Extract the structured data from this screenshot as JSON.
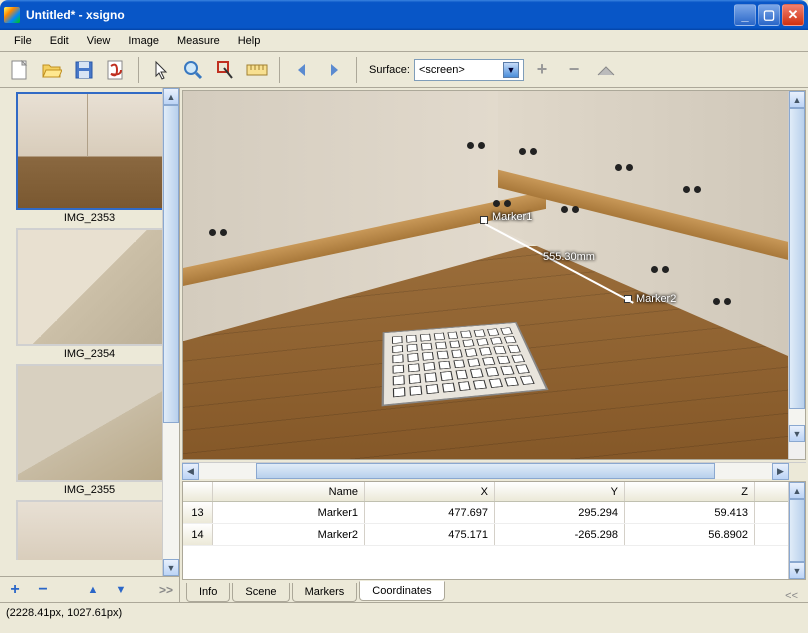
{
  "window": {
    "title": "Untitled* - xsigno"
  },
  "menu": {
    "items": [
      "File",
      "Edit",
      "View",
      "Image",
      "Measure",
      "Help"
    ]
  },
  "toolbar": {
    "surface_label": "Surface:",
    "surface_value": "<screen>"
  },
  "thumbs": [
    {
      "label": "IMG_2353",
      "selected": true
    },
    {
      "label": "IMG_2354",
      "selected": false
    },
    {
      "label": "IMG_2355",
      "selected": false
    },
    {
      "label": "",
      "selected": false
    }
  ],
  "viewer": {
    "marker1_label": "Marker1",
    "marker2_label": "Marker2",
    "measure": "555.30mm"
  },
  "table": {
    "columns": [
      "",
      "Name",
      "X",
      "Y",
      "Z"
    ],
    "rows": [
      {
        "n": "13",
        "name": "Marker1",
        "x": "477.697",
        "y": "295.294",
        "z": "59.413"
      },
      {
        "n": "14",
        "name": "Marker2",
        "x": "475.171",
        "y": "-265.298",
        "z": "56.8902"
      }
    ]
  },
  "tabs": {
    "items": [
      "Info",
      "Scene",
      "Markers",
      "Coordinates"
    ],
    "active": 3,
    "rr": "<<"
  },
  "leftnav": {
    "plus": "+",
    "minus": "−",
    "up": "▲",
    "down": "▼",
    "rr": ">>"
  },
  "status": {
    "coords": "(2228.41px, 1027.61px)"
  }
}
